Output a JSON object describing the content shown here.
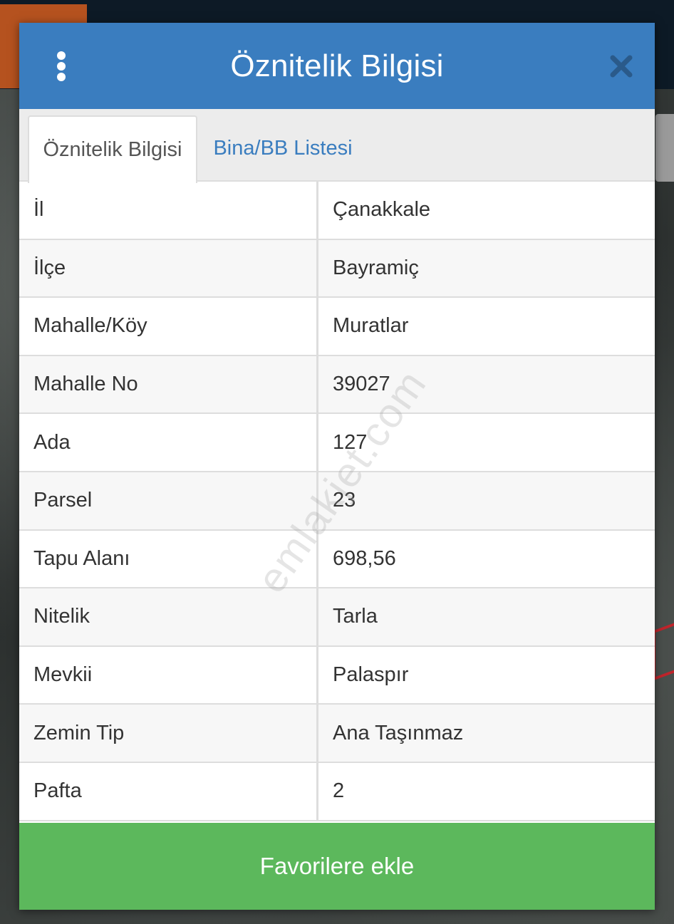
{
  "dialog": {
    "title": "Öznitelik Bilgisi"
  },
  "tabs": [
    {
      "label": "Öznitelik Bilgisi",
      "active": true
    },
    {
      "label": "Bina/BB Listesi",
      "active": false
    }
  ],
  "attributes": [
    {
      "key": "İl",
      "value": "Çanakkale"
    },
    {
      "key": "İlçe",
      "value": "Bayramiç"
    },
    {
      "key": "Mahalle/Köy",
      "value": "Muratlar"
    },
    {
      "key": "Mahalle No",
      "value": "39027"
    },
    {
      "key": "Ada",
      "value": "127"
    },
    {
      "key": "Parsel",
      "value": "23"
    },
    {
      "key": "Tapu Alanı",
      "value": "698,56"
    },
    {
      "key": "Nitelik",
      "value": "Tarla"
    },
    {
      "key": "Mevkii",
      "value": "Palaspır"
    },
    {
      "key": "Zemin Tip",
      "value": "Ana Taşınmaz"
    },
    {
      "key": "Pafta",
      "value": "2"
    }
  ],
  "actions": {
    "favorite_label": "Favorilere ekle"
  },
  "watermark": "emlakjet.com",
  "colors": {
    "header": "#3a7dbf",
    "tab_link": "#3a7dbf",
    "favorite_button": "#5cb85c"
  },
  "icons": {
    "menu": "vertical-dots-icon",
    "close": "close-icon"
  }
}
